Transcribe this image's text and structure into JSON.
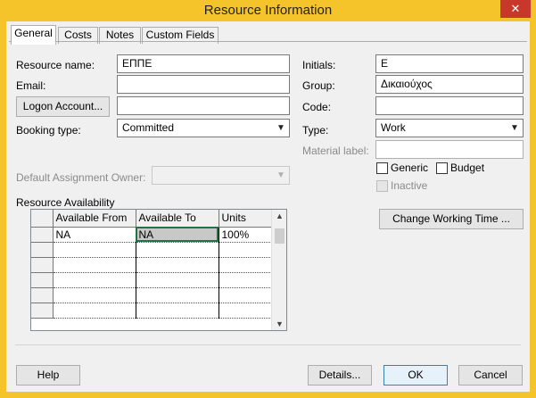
{
  "window": {
    "title": "Resource Information",
    "close_glyph": "✕"
  },
  "tabs": [
    {
      "label": "General",
      "active": true
    },
    {
      "label": "Costs",
      "active": false
    },
    {
      "label": "Notes",
      "active": false
    },
    {
      "label": "Custom Fields",
      "active": false
    }
  ],
  "general": {
    "resource_name_label": "Resource name:",
    "resource_name_value": "ΕΠΠΕ",
    "email_label": "Email:",
    "email_value": "",
    "logon_button": "Logon Account...",
    "logon_value": "",
    "booking_type_label": "Booking type:",
    "booking_type_value": "Committed",
    "default_owner_label": "Default Assignment Owner:",
    "default_owner_value": "",
    "initials_label": "Initials:",
    "initials_value": "Ε",
    "group_label": "Group:",
    "group_value": "Δικαιούχος",
    "code_label": "Code:",
    "code_value": "",
    "type_label": "Type:",
    "type_value": "Work",
    "material_label_label": "Material label:",
    "material_label_value": "",
    "generic_label": "Generic",
    "budget_label": "Budget",
    "inactive_label": "Inactive",
    "change_working_time_button": "Change Working Time ..."
  },
  "availability": {
    "section_label": "Resource Availability",
    "columns": [
      "Available From",
      "Available To",
      "Units"
    ],
    "rows": [
      [
        "NA",
        "NA",
        "100%"
      ],
      [
        "",
        "",
        ""
      ],
      [
        "",
        "",
        ""
      ],
      [
        "",
        "",
        ""
      ],
      [
        "",
        "",
        ""
      ],
      [
        "",
        "",
        ""
      ]
    ]
  },
  "footer": {
    "help_button": "Help",
    "details_button": "Details...",
    "ok_button": "OK",
    "cancel_button": "Cancel"
  },
  "colors": {
    "frame": "#f5c32a",
    "close": "#c7372a",
    "client": "#f0f0f0"
  }
}
